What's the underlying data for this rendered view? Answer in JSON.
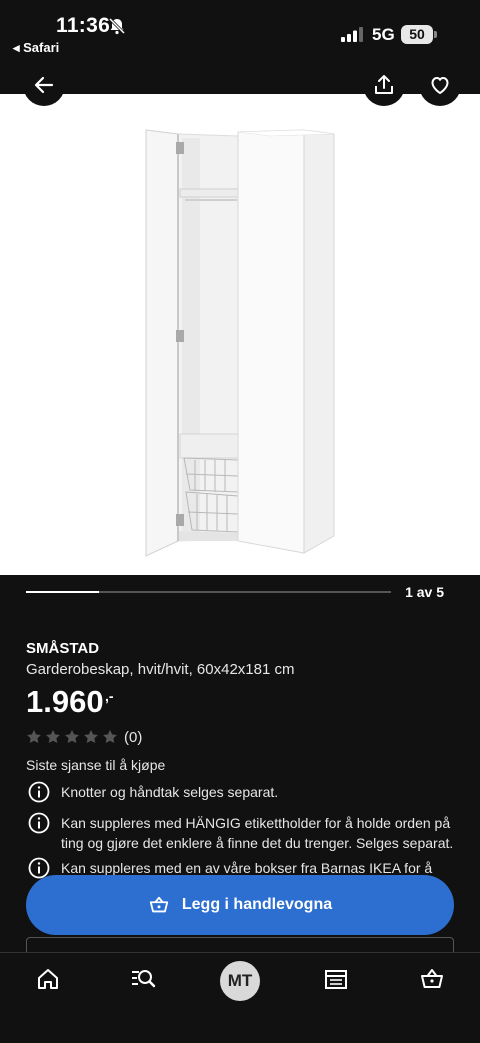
{
  "status_bar": {
    "time": "11:36",
    "back_app": "◂ Safari",
    "network": "5G",
    "battery": "50"
  },
  "carousel": {
    "counter": "1 av 5",
    "progress": 0.2
  },
  "product": {
    "name": "SMÅSTAD",
    "description": "Garderobeskap, hvit/hvit, 60x42x181 cm",
    "price": "1.960",
    "price_suffix": ",-",
    "rating_stars": 0,
    "review_count": "(0)",
    "availability": "Siste sjanse til å kjøpe"
  },
  "info_notes": [
    "Knotter og håndtak selges separat.",
    "Kan suppleres med HÄNGIG etikettholder for å holde orden på ting og gjøre det enklere å finne det du trenger. Selges separat.",
    "Kan suppleres med en av våre bokser fra Barnas IKEA for å"
  ],
  "cart_button": {
    "label": "Legg i handlevogna"
  },
  "nav": {
    "avatar_initials": "MT"
  },
  "colors": {
    "accent": "#2d6fd0",
    "background": "#111111"
  },
  "icons": [
    "back-arrow-icon",
    "share-icon",
    "heart-icon",
    "star-icon",
    "info-icon",
    "basket-icon",
    "home-icon",
    "search-list-icon",
    "store-icon"
  ]
}
